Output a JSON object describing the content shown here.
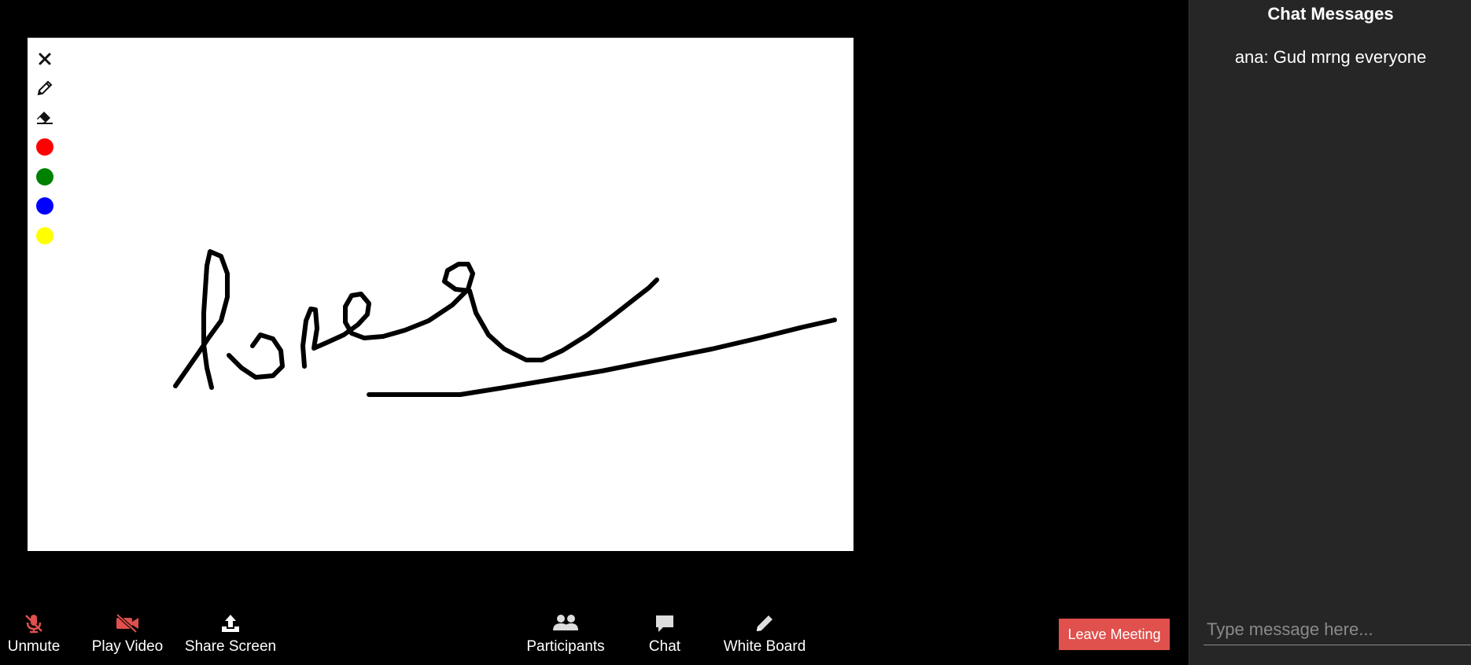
{
  "whiteboard": {
    "tools": [
      {
        "name": "close-icon"
      },
      {
        "name": "pencil-icon"
      },
      {
        "name": "eraser-icon"
      }
    ],
    "colors": [
      "#ff0000",
      "#008000",
      "#0000ff",
      "#ffff00"
    ]
  },
  "controls": {
    "unmute_label": "Unmute",
    "play_video_label": "Play Video",
    "share_screen_label": "Share Screen",
    "participants_label": "Participants",
    "chat_label": "Chat",
    "whiteboard_label": "White Board",
    "leave_label": "Leave Meeting",
    "muted_color": "#e0504c"
  },
  "chat": {
    "title": "Chat Messages",
    "messages": [
      "ana: Gud mrng everyone"
    ],
    "placeholder": "Type message here..."
  }
}
